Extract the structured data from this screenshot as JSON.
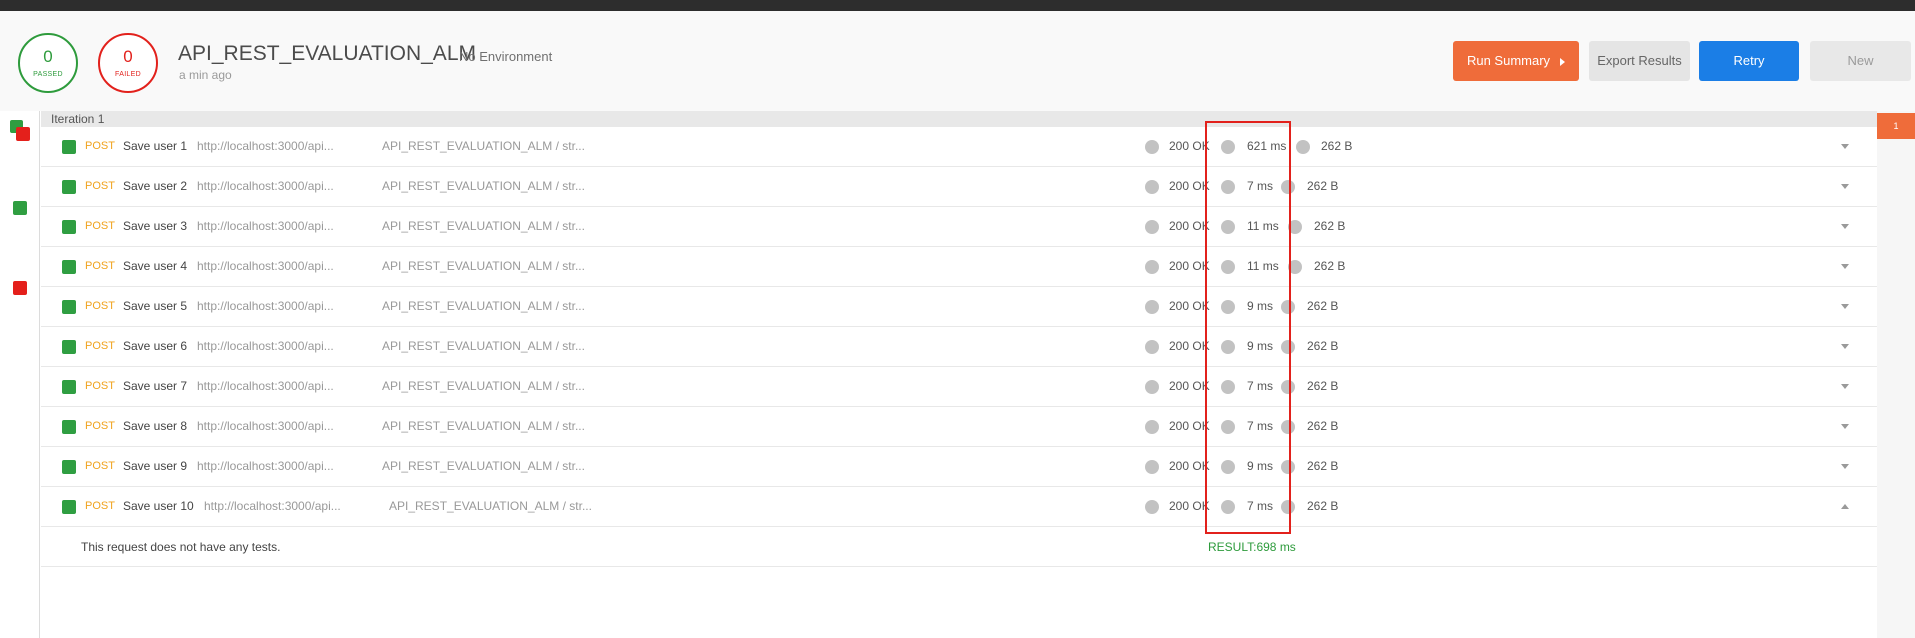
{
  "summary": {
    "passed_count": "0",
    "passed_label": "PASSED",
    "failed_count": "0",
    "failed_label": "FAILED",
    "run_title": "API_REST_EVALUATION_ALM",
    "environment": "No Environment",
    "time_ago": "a min ago"
  },
  "actions": {
    "run_summary": "Run Summary",
    "export_results": "Export Results",
    "retry": "Retry",
    "new": "New"
  },
  "iteration": {
    "label": "Iteration 1",
    "badge": "1"
  },
  "colors": {
    "passed": "#2e9b3c",
    "failed": "#e2211c",
    "accent": "#ef6c3a",
    "primary": "#1b7ee6",
    "method": "#f0a31e"
  },
  "requests": [
    {
      "method": "POST",
      "name": "Save user 1",
      "url": "http://localhost:3000/api...",
      "path": "API_REST_EVALUATION_ALM / str...",
      "status": "200 OK",
      "time": "621 ms",
      "size": "262 B"
    },
    {
      "method": "POST",
      "name": "Save user 2",
      "url": "http://localhost:3000/api...",
      "path": "API_REST_EVALUATION_ALM / str...",
      "status": "200 OK",
      "time": "7 ms",
      "size": "262 B"
    },
    {
      "method": "POST",
      "name": "Save user 3",
      "url": "http://localhost:3000/api...",
      "path": "API_REST_EVALUATION_ALM / str...",
      "status": "200 OK",
      "time": "11 ms",
      "size": "262 B"
    },
    {
      "method": "POST",
      "name": "Save user 4",
      "url": "http://localhost:3000/api...",
      "path": "API_REST_EVALUATION_ALM / str...",
      "status": "200 OK",
      "time": "11 ms",
      "size": "262 B"
    },
    {
      "method": "POST",
      "name": "Save user 5",
      "url": "http://localhost:3000/api...",
      "path": "API_REST_EVALUATION_ALM / str...",
      "status": "200 OK",
      "time": "9 ms",
      "size": "262 B"
    },
    {
      "method": "POST",
      "name": "Save user 6",
      "url": "http://localhost:3000/api...",
      "path": "API_REST_EVALUATION_ALM / str...",
      "status": "200 OK",
      "time": "9 ms",
      "size": "262 B"
    },
    {
      "method": "POST",
      "name": "Save user 7",
      "url": "http://localhost:3000/api...",
      "path": "API_REST_EVALUATION_ALM / str...",
      "status": "200 OK",
      "time": "7 ms",
      "size": "262 B"
    },
    {
      "method": "POST",
      "name": "Save user 8",
      "url": "http://localhost:3000/api...",
      "path": "API_REST_EVALUATION_ALM / str...",
      "status": "200 OK",
      "time": "7 ms",
      "size": "262 B"
    },
    {
      "method": "POST",
      "name": "Save user 9",
      "url": "http://localhost:3000/api...",
      "path": "API_REST_EVALUATION_ALM / str...",
      "status": "200 OK",
      "time": "9 ms",
      "size": "262 B"
    },
    {
      "method": "POST",
      "name": "Save user 10",
      "url": "http://localhost:3000/api...",
      "path": "API_REST_EVALUATION_ALM / str...",
      "status": "200 OK",
      "time": "7 ms",
      "size": "262 B"
    }
  ],
  "detail": {
    "no_tests": "This request does not have any tests.",
    "result": "RESULT:698 ms"
  }
}
